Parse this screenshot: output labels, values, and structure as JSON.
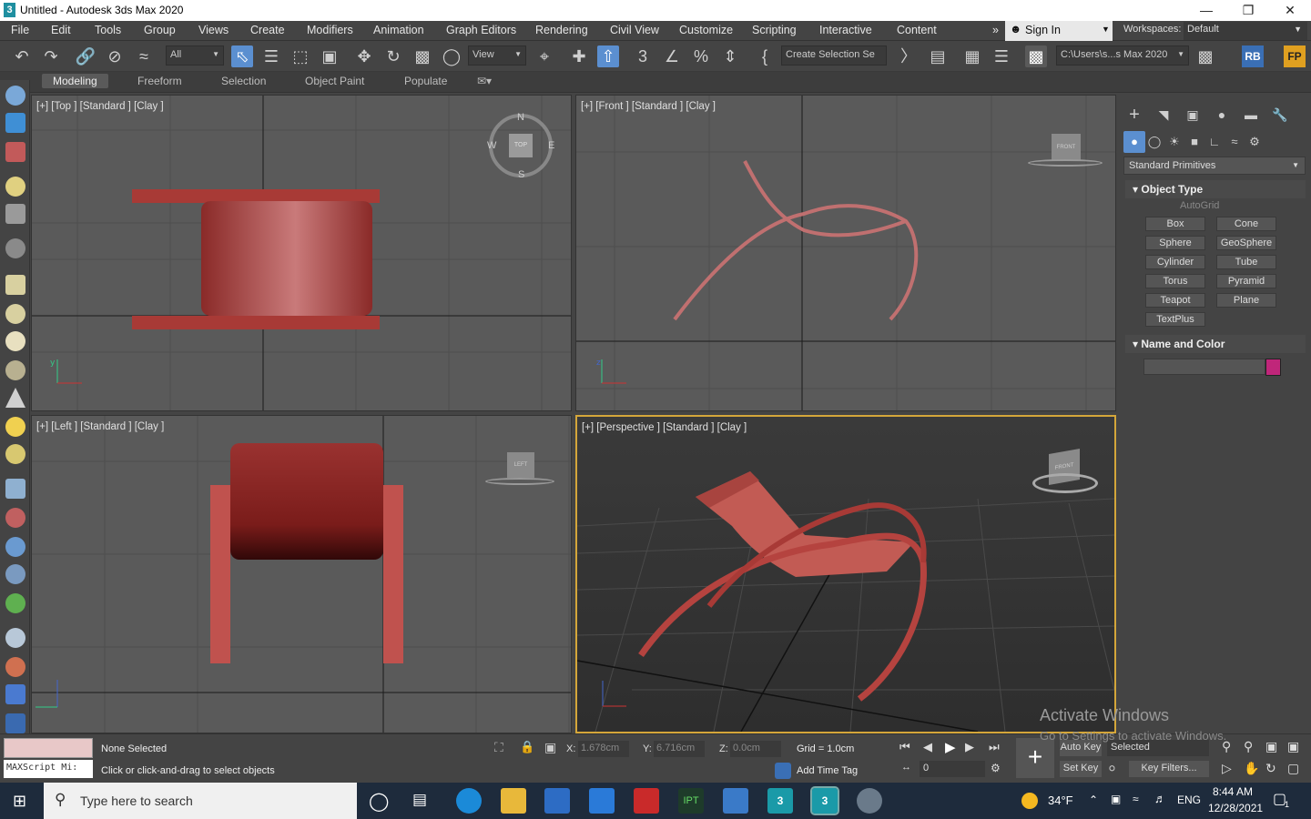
{
  "window": {
    "title": "Untitled - Autodesk 3ds Max 2020",
    "app_icon": "3"
  },
  "menu": [
    "File",
    "Edit",
    "Tools",
    "Group",
    "Views",
    "Create",
    "Modifiers",
    "Animation",
    "Graph Editors",
    "Rendering",
    "Civil View",
    "Customize",
    "Scripting",
    "Interactive",
    "Content"
  ],
  "signin": {
    "label": "Sign In"
  },
  "workspaces": {
    "label": "Workspaces:",
    "value": "Default"
  },
  "toolbar": {
    "filter": "All",
    "ref_coord": "View",
    "selection_set": "Create Selection Se",
    "project_path": "C:\\Users\\s...s Max 2020",
    "rb_label": "RB",
    "fp_label": "FP"
  },
  "ribbon": {
    "tabs": [
      "Modeling",
      "Freeform",
      "Selection",
      "Object Paint",
      "Populate"
    ],
    "active": "Modeling"
  },
  "viewports": {
    "top": {
      "label": "[+] [Top ] [Standard ] [Clay ]",
      "compass": {
        "n": "N",
        "s": "S",
        "e": "E",
        "w": "W",
        "center": "TOP"
      }
    },
    "front": {
      "label": "[+] [Front ] [Standard ] [Clay ]",
      "cube": "FRONT"
    },
    "left": {
      "label": "[+] [Left ] [Standard ] [Clay ]",
      "cube": "LEFT"
    },
    "perspective": {
      "label": "[+] [Perspective ] [Standard ] [Clay ]",
      "cube": "FRONT"
    }
  },
  "command_panel": {
    "category": "Standard Primitives",
    "object_type_title": "Object Type",
    "autogrid": "AutoGrid",
    "buttons": [
      "Box",
      "Cone",
      "Sphere",
      "GeoSphere",
      "Cylinder",
      "Tube",
      "Torus",
      "Pyramid",
      "Teapot",
      "Plane",
      "TextPlus"
    ],
    "name_color_title": "Name and Color",
    "swatch_color": "#c0267a"
  },
  "status": {
    "maxscript": "MAXScript Mi:",
    "selection": "None Selected",
    "prompt": "Click or click-and-drag to select objects",
    "x_label": "X:",
    "x_value": "1.678cm",
    "y_label": "Y:",
    "y_value": "6.716cm",
    "z_label": "Z:",
    "z_value": "0.0cm",
    "grid": "Grid = 1.0cm",
    "add_time_tag": "Add Time Tag",
    "frame": "0",
    "auto_key": "Auto Key",
    "set_key": "Set Key",
    "key_mode": "Selected",
    "key_filters": "Key Filters...",
    "watermark_title": "Activate Windows",
    "watermark_sub": "Go to Settings to activate Windows."
  },
  "taskbar": {
    "search_placeholder": "Type here to search",
    "weather": "34°F",
    "lang": "ENG",
    "time": "8:44 AM",
    "date": "12/28/2021",
    "notif_count": "1"
  },
  "colors": {
    "chair": "#b5433f",
    "chair_dark": "#7a1c1a",
    "viewport_bg": "#5a5a5a",
    "persp_border": "#d4a63a"
  }
}
